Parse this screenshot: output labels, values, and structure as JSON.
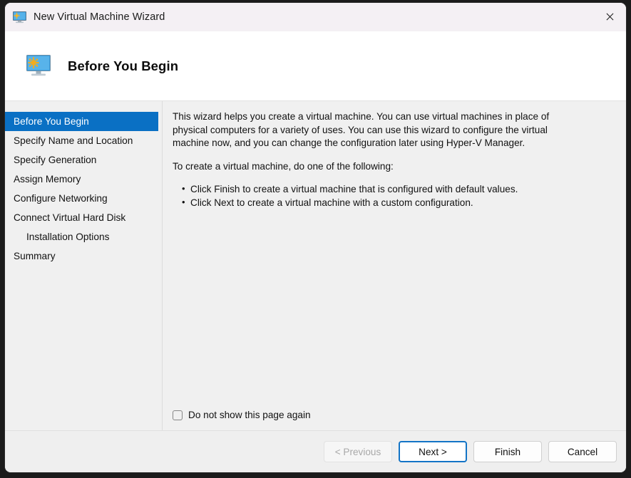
{
  "window": {
    "title": "New Virtual Machine Wizard",
    "title_icon": "virtual-machine-monitor-icon",
    "close_label": "✕",
    "accent_color": "#0a70c4",
    "titlebar_color": "#f4f0f4",
    "body_color": "#f0f0f0"
  },
  "header": {
    "icon": "virtual-machine-monitor-icon",
    "title": "Before You Begin"
  },
  "sidebar": {
    "items": [
      {
        "label": "Before You Begin",
        "selected": true,
        "indented": false
      },
      {
        "label": "Specify Name and Location",
        "selected": false,
        "indented": false
      },
      {
        "label": "Specify Generation",
        "selected": false,
        "indented": false
      },
      {
        "label": "Assign Memory",
        "selected": false,
        "indented": false
      },
      {
        "label": "Configure Networking",
        "selected": false,
        "indented": false
      },
      {
        "label": "Connect Virtual Hard Disk",
        "selected": false,
        "indented": false
      },
      {
        "label": "Installation Options",
        "selected": false,
        "indented": true
      },
      {
        "label": "Summary",
        "selected": false,
        "indented": false
      }
    ]
  },
  "main": {
    "paragraph1": "This wizard helps you create a virtual machine. You can use virtual machines in place of physical computers for a variety of uses. You can use this wizard to configure the virtual machine now, and you can change the configuration later using Hyper-V Manager.",
    "paragraph2": "To create a virtual machine, do one of the following:",
    "bullets": [
      "Click Finish to create a virtual machine that is configured with default values.",
      "Click Next to create a virtual machine with a custom configuration."
    ],
    "checkbox": {
      "label": "Do not show this page again",
      "checked": false
    }
  },
  "footer": {
    "buttons": [
      {
        "label": "< Previous",
        "state": "disabled"
      },
      {
        "label": "Next >",
        "state": "focused"
      },
      {
        "label": "Finish",
        "state": "normal"
      },
      {
        "label": "Cancel",
        "state": "normal"
      }
    ]
  }
}
